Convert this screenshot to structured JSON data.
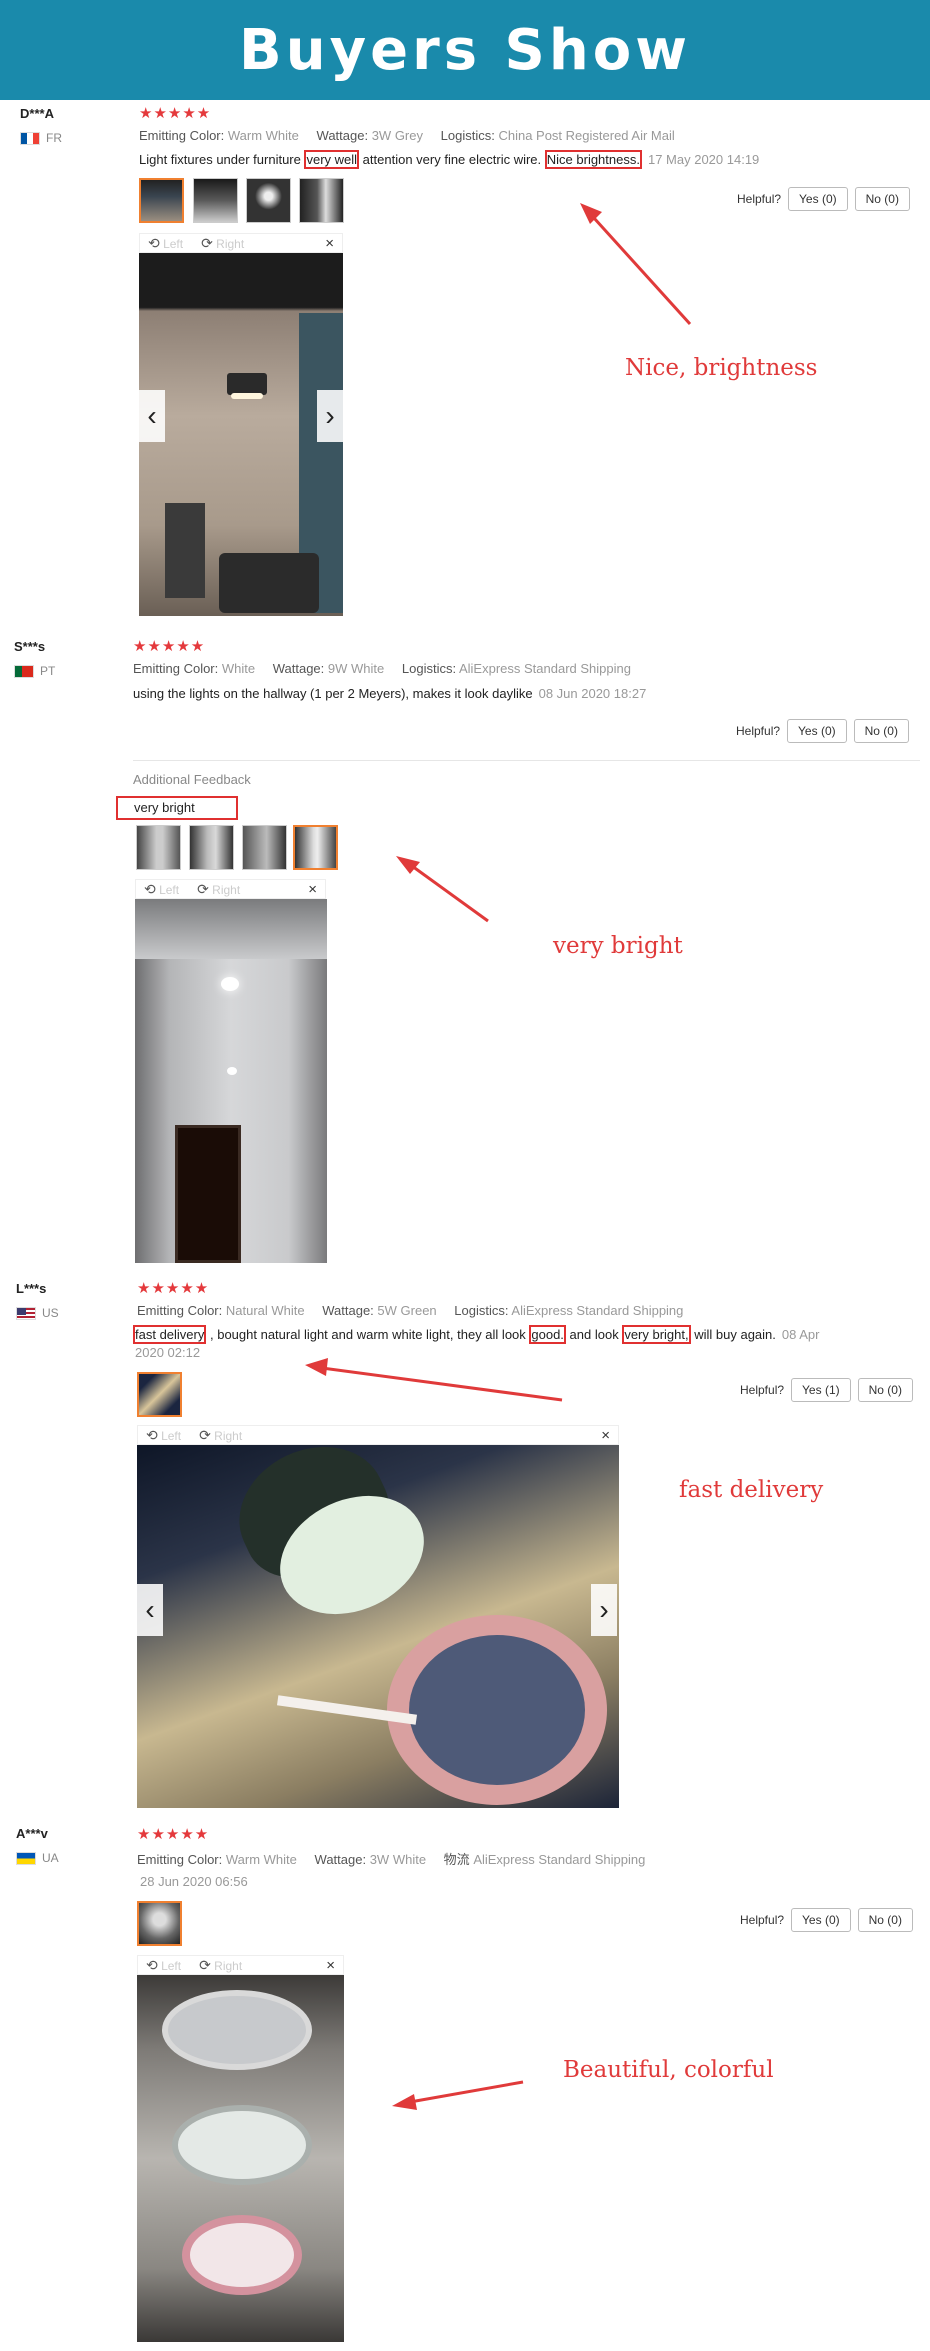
{
  "banner": {
    "title": "Buyers Show"
  },
  "labels": {
    "emitting_color": "Emitting Color:",
    "wattage": "Wattage:",
    "logistics": "Logistics:",
    "logistics_cn": "物流",
    "helpful": "Helpful?",
    "left": "Left",
    "right": "Right"
  },
  "icons": {
    "rotate_left": "rotate-left-icon",
    "rotate_right": "rotate-right-icon",
    "close": "close-icon",
    "prev": "chevron-left-icon",
    "next": "chevron-right-icon",
    "star": "star-icon",
    "flag": "flag-icon"
  },
  "colors": {
    "banner": "#1a8aab",
    "star": "#e4393c",
    "annotation": "#e03a3a",
    "selected_thumb": "#f08030"
  },
  "reviews": [
    {
      "name": "D***A",
      "country": "FR",
      "stars": "★★★★★",
      "color": "Warm White",
      "wattage": "3W Grey",
      "logistics": "China Post Registered Air Mail",
      "text_a": "Light fixtures under furniture ",
      "hl_1": "very well",
      "text_b": " attention very fine electric wire. ",
      "hl_2": "Nice brightness.",
      "date": "17 May 2020 14:19",
      "yes": "Yes (0)",
      "no": "No (0)",
      "annotation": "Nice, brightness"
    },
    {
      "name": "S***s",
      "country": "PT",
      "stars": "★★★★★",
      "color": "White",
      "wattage": "9W White",
      "logistics": "AliExpress Standard Shipping",
      "text": "using the lights on the hallway (1 per 2 Meyers), makes it look daylike",
      "date": "08 Jun 2020 18:27",
      "yes": "Yes (0)",
      "no": "No (0)",
      "additional_label": "Additional Feedback",
      "additional_text": "very bright",
      "annotation": "very bright"
    },
    {
      "name": "L***s",
      "country": "US",
      "stars": "★★★★★",
      "color": "Natural White",
      "wattage": "5W Green",
      "logistics": "AliExpress Standard Shipping",
      "hl_1": "fast delivery",
      "text_a": " , bought natural light and warm white light, they all look ",
      "hl_2": "good.",
      "text_b": " and look ",
      "hl_3": "very bright,",
      "text_c": " will buy again.",
      "date_a": "08 Apr",
      "date_b": "2020 02:12",
      "yes": "Yes (1)",
      "no": "No (0)",
      "annotation": "fast delivery"
    },
    {
      "name": "A***v",
      "country": "UA",
      "stars": "★★★★★",
      "color": "Warm White",
      "wattage": "3W White",
      "logistics": "AliExpress Standard Shipping",
      "date": "28 Jun 2020 06:56",
      "yes": "Yes (0)",
      "no": "No (0)",
      "annotation": "Beautiful, colorful"
    }
  ]
}
